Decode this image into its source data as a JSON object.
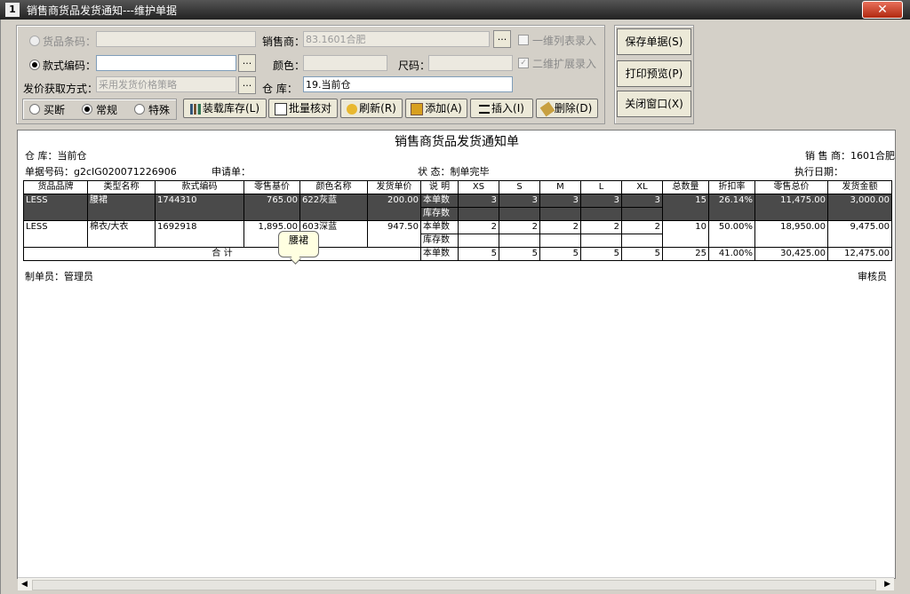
{
  "window": {
    "title": "销售商货品发货通知---维护单据",
    "app_icon": "1",
    "close_label": "✕"
  },
  "form": {
    "barcode_label": "货品条码：",
    "barcode_value": "",
    "style_code_label": "款式编码：",
    "style_code_value": "",
    "price_method_label": "发价获取方式：",
    "price_method_value": "采用发货价格策略",
    "dealer_label": "销售商：",
    "dealer_value": "83.1601合肥",
    "color_label": "颜色：",
    "color_value": "",
    "size_label": "尺码：",
    "size_value": "",
    "warehouse_label": "仓  库：",
    "warehouse_value": "19.当前仓",
    "one_dim_label": "一维列表录入",
    "two_dim_label": "二维扩展录入",
    "dots_label": "...",
    "price_types": [
      "买断",
      "常规",
      "特殊"
    ],
    "price_type_selected": "常规"
  },
  "toolbar": {
    "load_stock": "装载库存(L)",
    "batch_check": "批量核对",
    "refresh": "刷新(R)",
    "add": "添加(A)",
    "insert": "插入(I)",
    "delete": "删除(D)"
  },
  "side_buttons": {
    "save": "保存单据(S)",
    "print_preview": "打印预览(P)",
    "close_window": "关闭窗口(X)"
  },
  "report": {
    "title": "销售商货品发货通知单",
    "warehouse": "仓      库：当前仓",
    "dealer": "销 售 商：1601合肥",
    "doc_no": "单据号码：g2cIG020071226906",
    "request": "申请单：",
    "status": "状  态：制单完毕",
    "exec_date": "执行日期：",
    "maker": "制单员：管理员",
    "auditor": "审核员",
    "columns": [
      "货品品牌",
      "类型名称",
      "款式编码",
      "零售基价",
      "颜色名称",
      "发货单价",
      "说  明",
      "XS",
      "S",
      "M",
      "L",
      "XL",
      "总数量",
      "折扣率",
      "零售总价",
      "发货金额"
    ],
    "rows": [
      {
        "brand": "LESS",
        "type": "腰裙",
        "code": "1744310",
        "retail_price": "765.00",
        "color": "622灰蓝",
        "unit_price": "200.00",
        "note1": "本单数",
        "note2": "库存数",
        "xs": "3",
        "s": "3",
        "m": "3",
        "l": "3",
        "xl": "3",
        "total": "15",
        "discount": "26.14%",
        "retail_total": "11,475.00",
        "amount": "3,000.00"
      },
      {
        "brand": "LESS",
        "type": "棉衣/大衣",
        "code": "1692918",
        "retail_price": "1,895.00",
        "color": "603深蓝",
        "unit_price": "947.50",
        "note1": "本单数",
        "note2": "库存数",
        "xs": "2",
        "s": "2",
        "m": "2",
        "l": "2",
        "xl": "2",
        "total": "10",
        "discount": "50.00%",
        "retail_total": "18,950.00",
        "amount": "9,475.00"
      }
    ],
    "sum": {
      "label": "合    计",
      "note": "本单数",
      "xs": "5",
      "s": "5",
      "m": "5",
      "l": "5",
      "xl": "5",
      "total": "25",
      "discount": "41.00%",
      "retail_total": "30,425.00",
      "amount": "12,475.00"
    },
    "tooltip": "腰裙"
  }
}
